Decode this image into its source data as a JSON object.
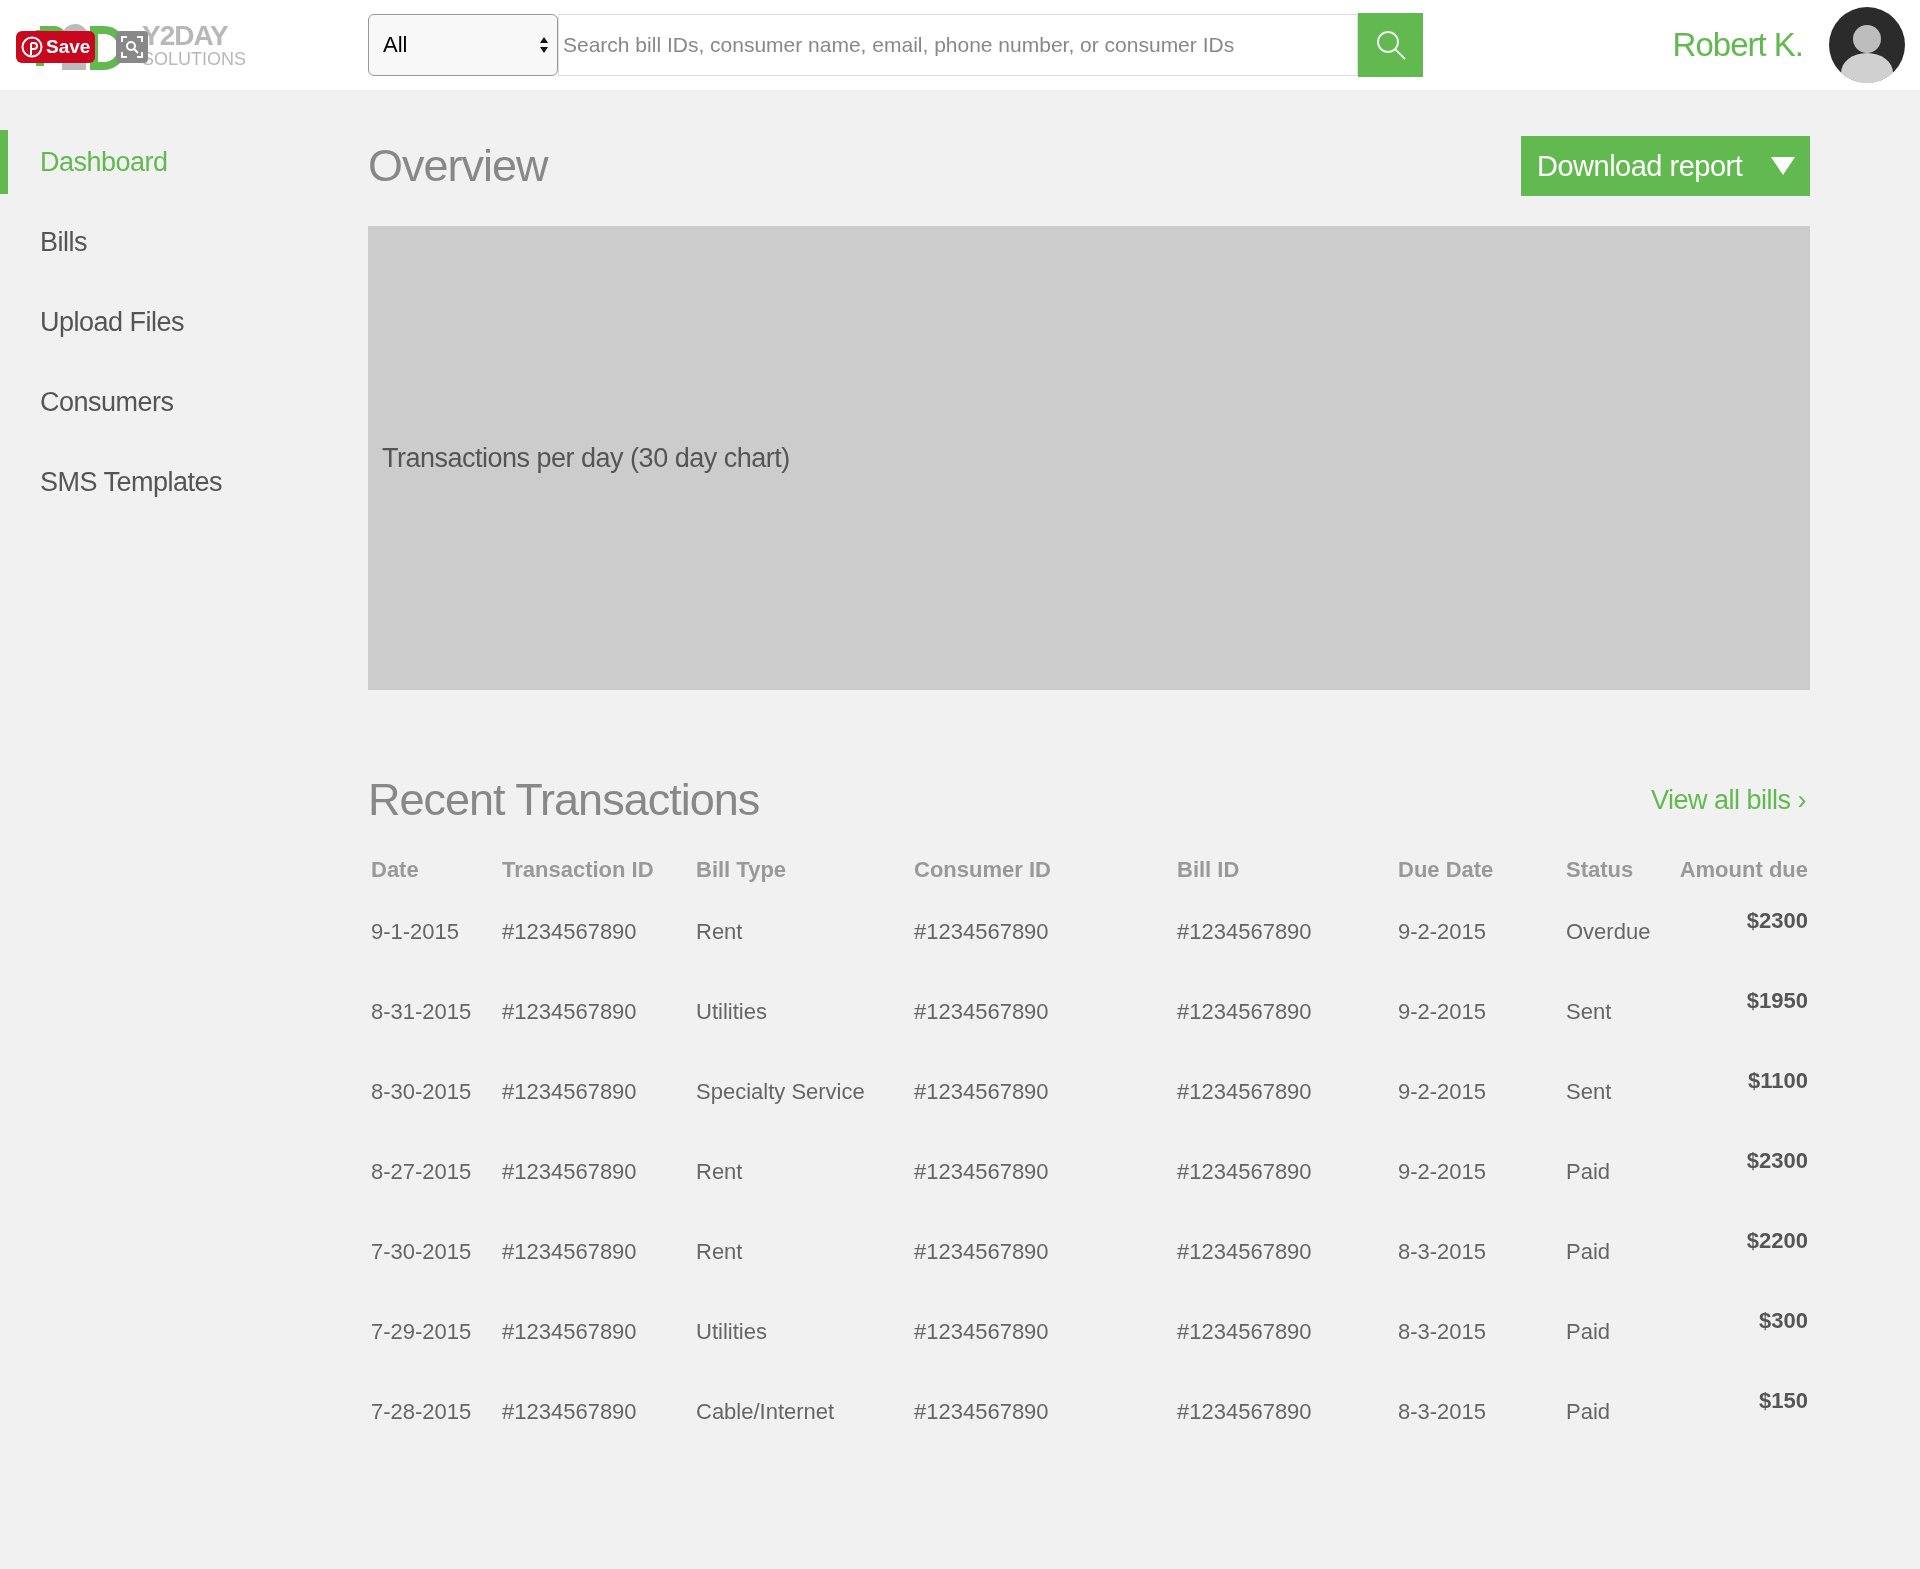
{
  "overlay": {
    "save_label": "Save"
  },
  "logo": {
    "line_1": "Y2DAY",
    "line_2": "SOLUTIONS"
  },
  "search": {
    "scope": "All",
    "placeholder": "Search bill IDs, consumer name, email, phone number, or consumer IDs"
  },
  "user": {
    "name": "Robert K."
  },
  "sidebar": {
    "items": [
      {
        "label": "Dashboard",
        "selected": true
      },
      {
        "label": "Bills",
        "selected": false
      },
      {
        "label": "Upload Files",
        "selected": false
      },
      {
        "label": "Consumers",
        "selected": false
      },
      {
        "label": "SMS Templates",
        "selected": false
      }
    ]
  },
  "overview": {
    "title": "Overview",
    "download_label": "Download report",
    "chart_caption": "Transactions per day (30 day chart)"
  },
  "transactions": {
    "title": "Recent Transactions",
    "link": "View all bills ›",
    "columns": [
      "Date",
      "Transaction ID",
      "Bill Type",
      "Consumer ID",
      "Bill ID",
      "Due Date",
      "Status",
      "Amount due"
    ],
    "rows": [
      [
        "9-1-2015",
        "#1234567890",
        "Rent",
        "#1234567890",
        "#1234567890",
        "9-2-2015",
        "Overdue",
        "$2300"
      ],
      [
        "8-31-2015",
        "#1234567890",
        "Utilities",
        "#1234567890",
        "#1234567890",
        "9-2-2015",
        "Sent",
        "$1950"
      ],
      [
        "8-30-2015",
        "#1234567890",
        "Specialty Service",
        "#1234567890",
        "#1234567890",
        "9-2-2015",
        "Sent",
        "$1100"
      ],
      [
        "8-27-2015",
        "#1234567890",
        "Rent",
        "#1234567890",
        "#1234567890",
        "9-2-2015",
        "Paid",
        "$2300"
      ],
      [
        "7-30-2015",
        "#1234567890",
        "Rent",
        "#1234567890",
        "#1234567890",
        "8-3-2015",
        "Paid",
        "$2200"
      ],
      [
        "7-29-2015",
        "#1234567890",
        "Utilities",
        "#1234567890",
        "#1234567890",
        "8-3-2015",
        "Paid",
        "$300"
      ],
      [
        "7-28-2015",
        "#1234567890",
        "Cable/Internet",
        "#1234567890",
        "#1234567890",
        "8-3-2015",
        "Paid",
        "$150"
      ]
    ]
  }
}
